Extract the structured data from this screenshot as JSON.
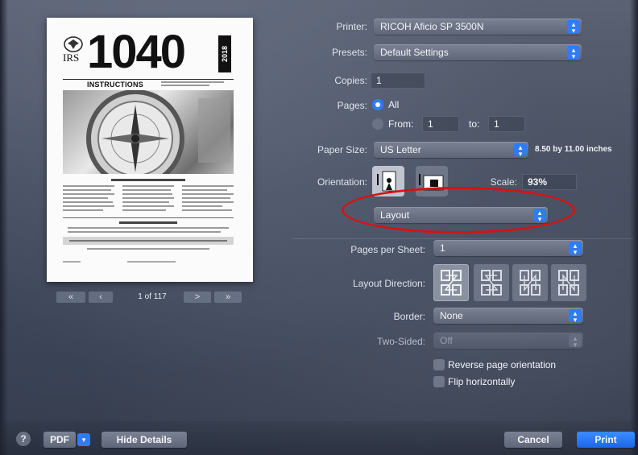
{
  "preview": {
    "irs": "IRS",
    "form_number": "1040",
    "year": "2018",
    "instructions_title": "INSTRUCTIONS",
    "page_indicator": "1 of 117"
  },
  "nav": {
    "first": "«",
    "prev": "‹",
    "next": ">",
    "last": "»"
  },
  "printer": {
    "label": "Printer:",
    "value": "RICOH Aficio SP 3500N"
  },
  "presets": {
    "label": "Presets:",
    "value": "Default Settings"
  },
  "copies": {
    "label": "Copies:",
    "value": "1"
  },
  "pages": {
    "label": "Pages:",
    "all": "All",
    "from_label": "From:",
    "from_value": "1",
    "to_label": "to:",
    "to_value": "1"
  },
  "paper_size": {
    "label": "Paper Size:",
    "value": "US Letter",
    "dimensions": "8.50 by 11.00 inches"
  },
  "orientation": {
    "label": "Orientation:"
  },
  "scale": {
    "label": "Scale:",
    "value": "93%"
  },
  "section": {
    "value": "Layout"
  },
  "pages_per_sheet": {
    "label": "Pages per Sheet:",
    "value": "1"
  },
  "layout_direction": {
    "label": "Layout Direction:"
  },
  "border": {
    "label": "Border:",
    "value": "None"
  },
  "two_sided": {
    "label": "Two-Sided:",
    "value": "Off"
  },
  "reverse_orientation": {
    "label": "Reverse page orientation"
  },
  "flip_horizontally": {
    "label": "Flip horizontally"
  },
  "footer": {
    "help": "?",
    "pdf": "PDF",
    "hide_details": "Hide Details",
    "cancel": "Cancel",
    "print": "Print"
  },
  "colors": {
    "accent": "#2f7cf6",
    "highlight_ellipse": "#d21414"
  }
}
